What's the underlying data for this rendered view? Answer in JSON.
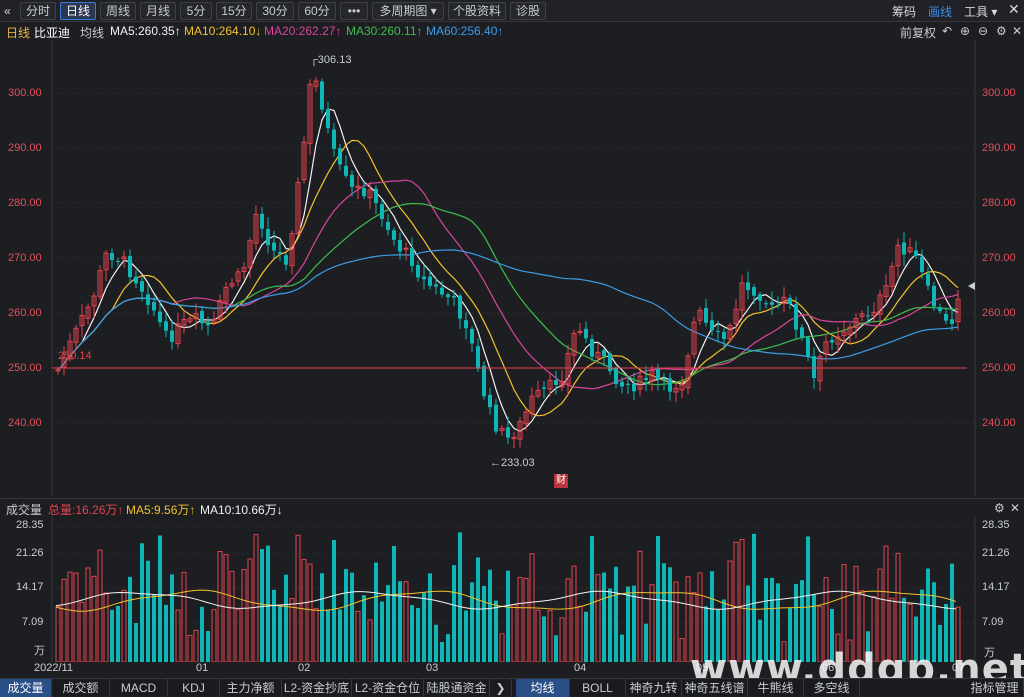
{
  "toolbar": {
    "back_glyph": "«",
    "tabs": [
      "分时",
      "日线",
      "周线",
      "月线",
      "5分",
      "15分",
      "30分",
      "60分",
      "•••",
      "多周期图 ▾",
      "个股资料",
      "诊股"
    ],
    "active_tab": "日线",
    "right": [
      "筹码",
      "画线",
      "工具 ▾"
    ]
  },
  "info": {
    "period": "日线",
    "stock_name": "比亚迪",
    "ma_label": "均线",
    "ma5": "MA5:260.35↑",
    "ma10": "MA10:264.10↓",
    "ma20": "MA20:262.27↑",
    "ma30": "MA30:260.11↑",
    "ma60": "MA60:256.40↑",
    "fuquan": "前复权"
  },
  "colors": {
    "up": "#e2434b",
    "down": "#10b5b5",
    "ma5": "#f2f2f2",
    "ma10": "#f2c32c",
    "ma20": "#d8459c",
    "ma30": "#3fbf4a",
    "ma60": "#3b9de8",
    "accent": "#3a7bd5"
  },
  "price_axis": [
    "300.00",
    "290.00",
    "280.00",
    "270.00",
    "260.00",
    "250.00",
    "240.00"
  ],
  "annotations": {
    "high": "306.13",
    "low": "←233.03",
    "ref": "250.14",
    "badge": "财"
  },
  "volume": {
    "title": "成交量",
    "total": "总量:16.26万↑",
    "ma5": "MA5:9.56万↑",
    "ma10": "MA10:10.66万↓",
    "axis": [
      "28.35",
      "21.26",
      "14.17",
      "7.09"
    ],
    "unit": "万"
  },
  "x_labels": [
    "2022/11",
    "01",
    "02",
    "03",
    "04",
    "05",
    "06",
    "07"
  ],
  "bottom_tabs": [
    "成交量",
    "成交额",
    "MACD",
    "KDJ",
    "主力净额",
    "L2-资金抄底",
    "L2-资金仓位",
    "陆股通资金",
    "❯",
    "均线",
    "BOLL",
    "神奇九转",
    "神奇五线谱",
    "牛熊线",
    "多空线",
    "指标管理"
  ],
  "watermark": "www.ddgp.net"
}
